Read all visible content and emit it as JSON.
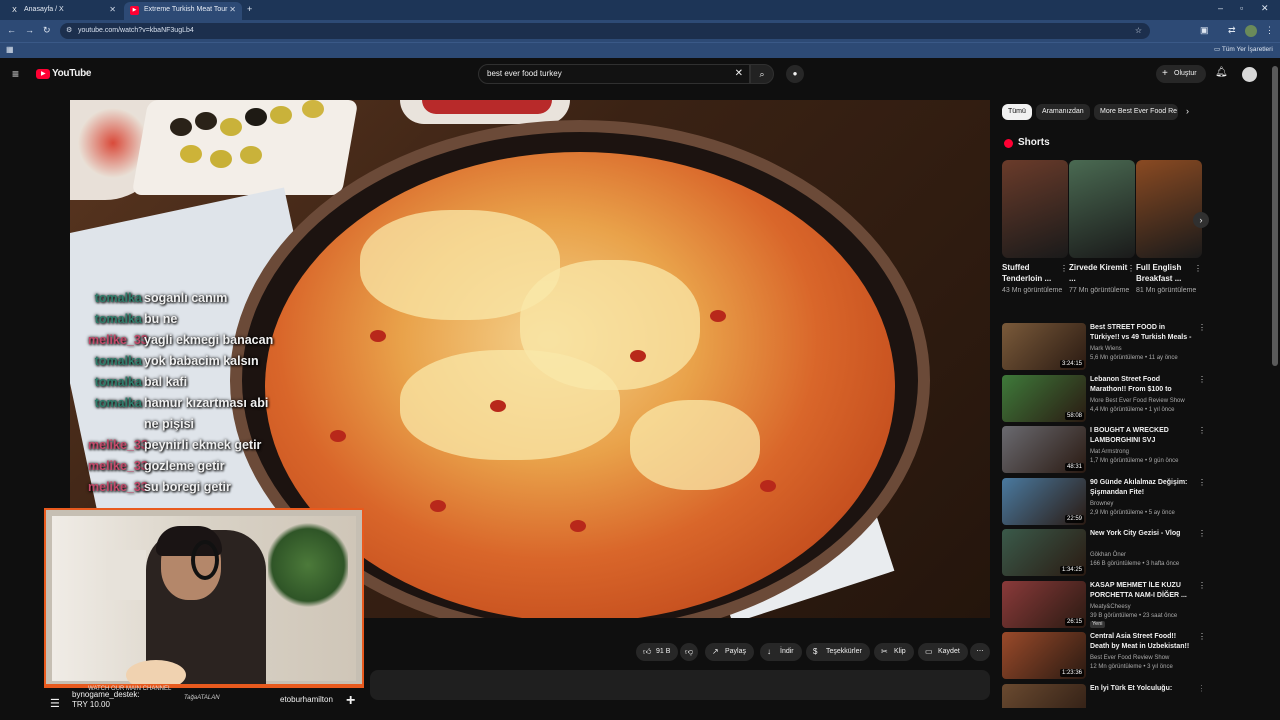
{
  "browser": {
    "tabs": [
      {
        "title": "Anasayfa / X",
        "favicon": "X"
      },
      {
        "title": "Extreme Turkish Meat Tour",
        "favicon": "▶"
      }
    ],
    "url": "youtube.com/watch?v=kbaNF3ugLb4",
    "bookmarks_all_label": "Tüm Yer İşaretleri"
  },
  "youtube": {
    "logo_text": "YouTube",
    "search_value": "best ever food turkey",
    "create_label": "Oluştur"
  },
  "chat": [
    {
      "user": "tomalka",
      "message": "soganlı canım",
      "color": "#2f7d6b"
    },
    {
      "user": "tomalka",
      "message": "bu ne",
      "color": "#2f7d6b"
    },
    {
      "user": "melike_33",
      "message": "yagli ekmegi banacan",
      "color": "#c44a6a"
    },
    {
      "user": "tomalka",
      "message": "yok babacim kalsın",
      "color": "#2f7d6b"
    },
    {
      "user": "tomalka",
      "message": "bal kafi",
      "color": "#2f7d6b"
    },
    {
      "user": "tomalka",
      "message": "hamur kızartması abi",
      "color": "#2f7d6b"
    },
    {
      "user": "",
      "message": "ne pişisi",
      "color": "#2f7d6b"
    },
    {
      "user": "melike_33",
      "message": "peynirli ekmek getir",
      "color": "#c44a6a"
    },
    {
      "user": "melike_33",
      "message": "gozleme getir",
      "color": "#c44a6a"
    },
    {
      "user": "melike_33",
      "message": "su boregi getir",
      "color": "#c44a6a"
    }
  ],
  "stream_overlay": {
    "donation_user": "bynogame_destek:",
    "donation_amount": "TRY 10.00",
    "channel_promo": "WATCH OUR MAIN CHANNEL",
    "signature": "TağaATALAN",
    "streamer": "etoburhamilton"
  },
  "actions": {
    "likes": "91 B",
    "share": "Paylaş",
    "download": "İndir",
    "thanks": "Teşekkürler",
    "clip": "Klip",
    "save": "Kaydet"
  },
  "sidebar": {
    "chips": [
      "Tümü",
      "Aramanızdan",
      "More Best Ever Food Re"
    ],
    "shorts_heading": "Shorts",
    "shorts": [
      {
        "title": "Stuffed Tenderloin ...",
        "views": "43 Mn görüntüleme",
        "color": "#6a3b2a"
      },
      {
        "title": "Zirvede Kiremit ...",
        "views": "77 Mn görüntüleme",
        "color": "#4a6a52"
      },
      {
        "title": "Full English Breakfast ...",
        "views": "81 Mn görüntüleme",
        "color": "#8a4a22"
      }
    ],
    "recommendations": [
      {
        "title": "Best STREET FOOD in Türkiye!! vs 49 Turkish Meals - Istanbul ...",
        "channel": "Mark Wiens",
        "meta": "5,6 Mn görüntüleme • 11 ay önce",
        "duration": "3:24:15",
        "color": "#7a5a3a",
        "new": false
      },
      {
        "title": "Lebanon Street Food Marathon!! From $100 to $1000!!",
        "channel": "More Best Ever Food Review Show",
        "meta": "4,4 Mn görüntüleme • 1 yıl önce",
        "duration": "58:08",
        "color": "#3e7a3a",
        "new": false
      },
      {
        "title": "I BOUGHT A WRECKED LAMBORGHINI SVJ",
        "channel": "Mat Armstrong",
        "meta": "1,7 Mn görüntüleme • 9 gün önce",
        "duration": "48:31",
        "color": "#6a6a70",
        "new": false
      },
      {
        "title": "90 Günde Akılalmaz Değişim: Şişmandan Fite!",
        "channel": "Browney",
        "meta": "2,9 Mn görüntüleme • 5 ay önce",
        "duration": "22:59",
        "color": "#4a7aa0",
        "new": false
      },
      {
        "title": "New York City Gezisi - Vlog",
        "channel": "Gökhan Öner",
        "meta": "166 B görüntüleme • 3 hafta önce",
        "duration": "1:34:25",
        "color": "#3a5a4a",
        "new": false
      },
      {
        "title": "KASAP MEHMET İLE KUZU PORCHETTA NAM-I DİĞER ...",
        "channel": "Meaty&Cheesy",
        "meta": "39 B görüntüleme • 23 saat önce",
        "duration": "26:15",
        "color": "#8a3a3a",
        "new": true
      },
      {
        "title": "Central Asia Street Food!! Death by Meat in Uzbekistan!! (Full ...",
        "channel": "Best Ever Food Review Show",
        "meta": "12 Mn görüntüleme • 3 yıl önce",
        "duration": "1:23:36",
        "color": "#9a4a2a",
        "new": false
      },
      {
        "title": "En İyi Türk Et Yolculuğu:",
        "channel": "",
        "meta": "",
        "duration": "",
        "color": "#6a4a30",
        "new": false
      }
    ],
    "new_badge": "Yeni"
  }
}
